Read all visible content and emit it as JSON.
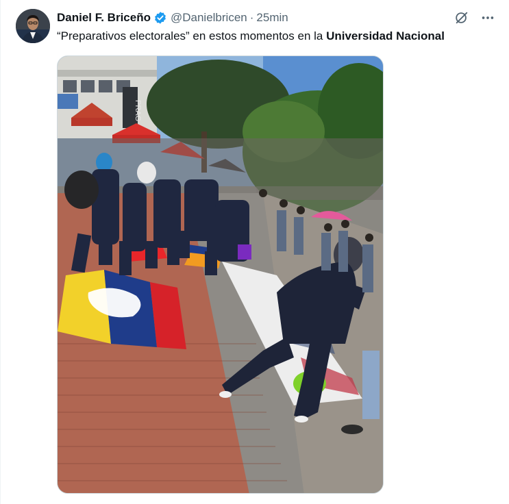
{
  "tweet": {
    "author_name": "Daniel F. Briceño",
    "handle": "@Danielbricen",
    "separator": "·",
    "timestamp": "25min",
    "text_prefix": "“Preparativos electorales” en estos momentos en la ",
    "text_bold": "Universidad Nacional"
  },
  "icons": {
    "verified": "verified-badge-icon",
    "grok": "grok-icon",
    "more": "more-icon"
  },
  "colors": {
    "verified_blue": "#1d9bf0",
    "secondary_text": "#536471",
    "primary_text": "#0f1419"
  },
  "media": {
    "text_on_wall": "PRAG"
  }
}
